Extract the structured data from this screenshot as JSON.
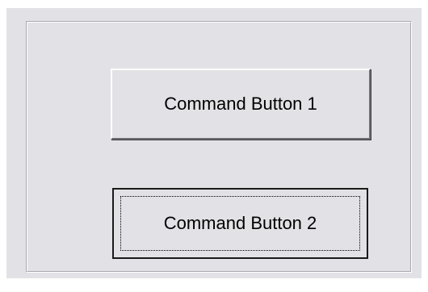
{
  "form": {
    "buttons": [
      {
        "label": "Command Button 1",
        "focused": false
      },
      {
        "label": "Command Button 2",
        "focused": true
      }
    ]
  },
  "colors": {
    "face": "#e2e2e6",
    "highlight": "#ffffff",
    "shadow": "#6e6e74",
    "focus_border": "#1a1a1a"
  }
}
